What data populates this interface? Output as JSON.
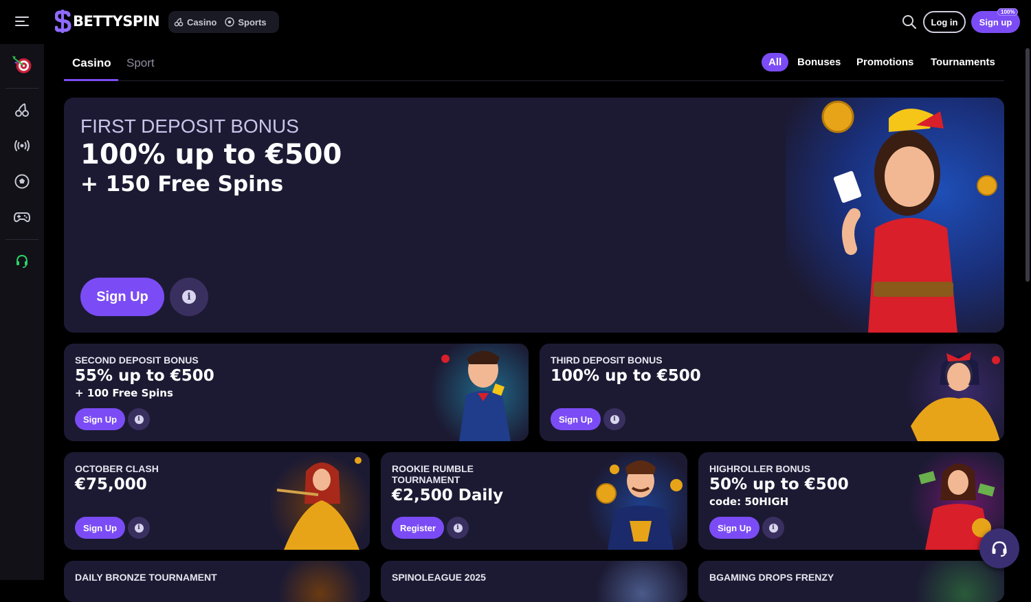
{
  "brand": {
    "name": "BETTYSPIN",
    "accent": "#7b4cf5"
  },
  "header": {
    "switcher": [
      {
        "label": "Casino",
        "icon": "cherry-icon"
      },
      {
        "label": "Sports",
        "icon": "soccer-ball-icon"
      }
    ],
    "login_label": "Log in",
    "signup_label": "Sign up",
    "signup_badge": "100%"
  },
  "sidebar": {
    "items": [
      {
        "name": "promotions-target-icon"
      },
      {
        "name": "casino-cherry-icon"
      },
      {
        "name": "live-broadcast-icon"
      },
      {
        "name": "sports-ball-icon"
      },
      {
        "name": "gamepad-icon"
      },
      {
        "name": "support-headset-icon"
      }
    ]
  },
  "tabs": {
    "casino": "Casino",
    "sport": "Sport"
  },
  "filters": {
    "all": "All",
    "bonuses": "Bonuses",
    "promotions": "Promotions",
    "tournaments": "Tournaments"
  },
  "hero": {
    "tag": "FIRST DEPOSIT BONUS",
    "title": "100% up to €500",
    "subtitle": "+ 150 Free Spins",
    "button": "Sign Up"
  },
  "cards_row1": [
    {
      "tag": "SECOND DEPOSIT BONUS",
      "title": "55% up to €500",
      "subtitle": "+ 100 Free Spins",
      "button": "Sign Up"
    },
    {
      "tag": "THIRD DEPOSIT BONUS",
      "title": "100% up to €500",
      "subtitle": "",
      "button": "Sign Up"
    }
  ],
  "cards_row2": [
    {
      "tag": "OCTOBER CLASH",
      "title": "€75,000",
      "subtitle": "",
      "button": "Sign Up"
    },
    {
      "tag": "ROOKIE RUMBLE TOURNAMENT",
      "title": "€2,500 Daily",
      "subtitle": "",
      "button": "Register"
    },
    {
      "tag": "HIGHROLLER BONUS",
      "title": "50% up to €500",
      "subtitle": "code: 50HIGH",
      "button": "Sign Up"
    }
  ],
  "cards_row3": [
    {
      "tag": "DAILY BRONZE TOURNAMENT"
    },
    {
      "tag": "SPINOLEAGUE 2025"
    },
    {
      "tag": "BGAMING DROPS FRENZY"
    }
  ]
}
